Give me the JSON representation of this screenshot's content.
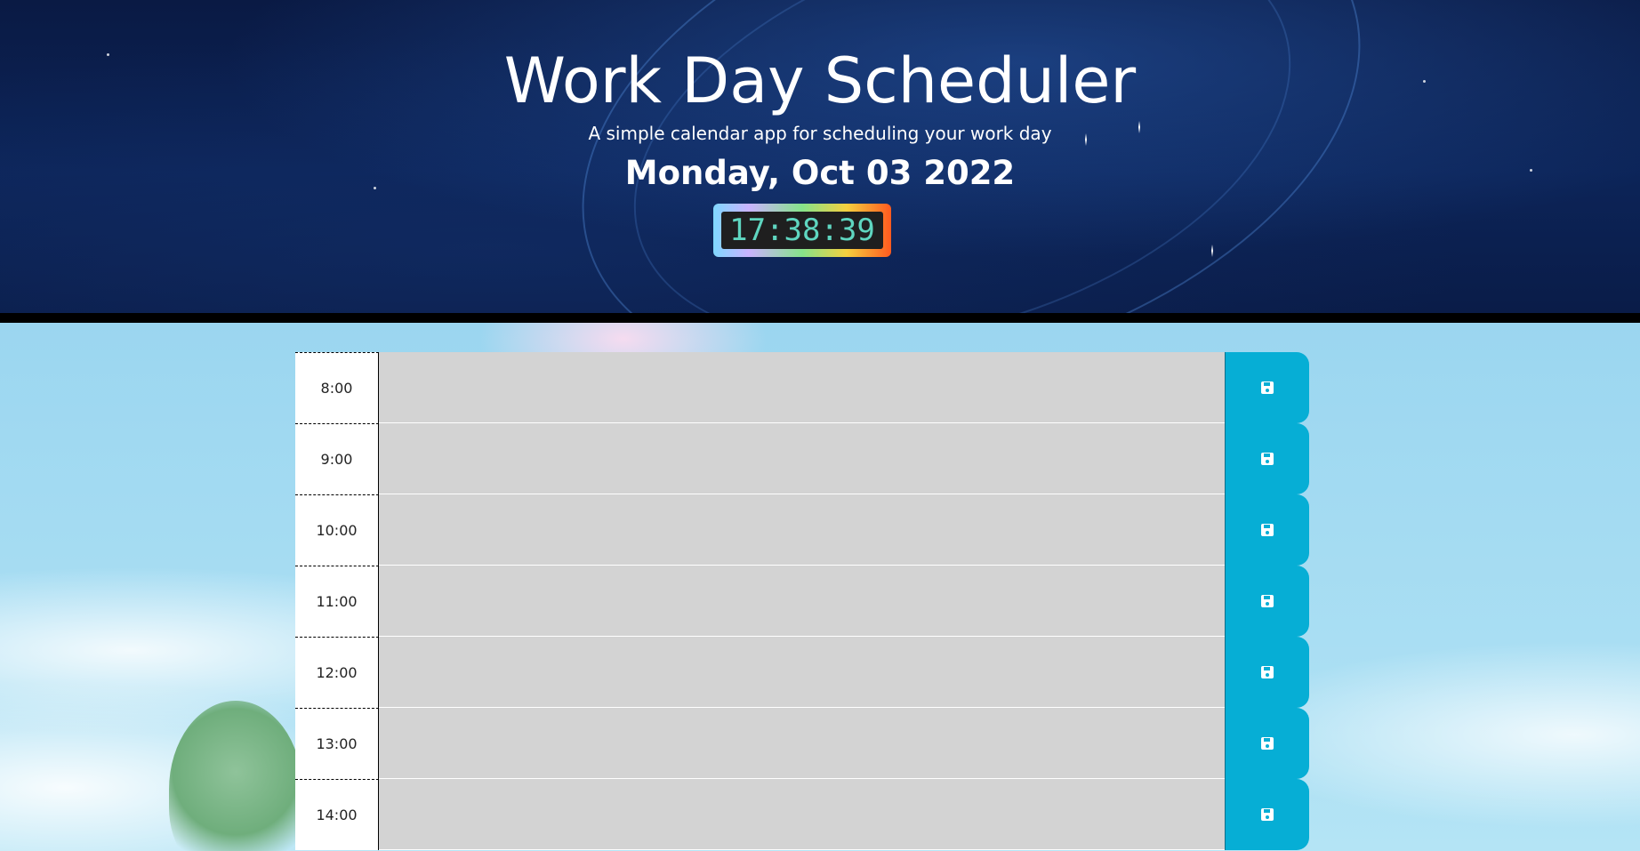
{
  "header": {
    "title": "Work Day Scheduler",
    "subtitle": "A simple calendar app for scheduling your work day",
    "date": "Monday, Oct 03 2022",
    "clock": "17:38:39"
  },
  "colors": {
    "header_bg": "#0a1a44",
    "past_row": "#d3d3d3",
    "save_button": "#06aed5",
    "clock_bg": "#1f1f1f"
  },
  "schedule": {
    "rows": [
      {
        "hour": "8:00",
        "task": ""
      },
      {
        "hour": "9:00",
        "task": ""
      },
      {
        "hour": "10:00",
        "task": ""
      },
      {
        "hour": "11:00",
        "task": ""
      },
      {
        "hour": "12:00",
        "task": ""
      },
      {
        "hour": "13:00",
        "task": ""
      },
      {
        "hour": "14:00",
        "task": ""
      }
    ],
    "save_icon": "floppy-disk-icon"
  }
}
